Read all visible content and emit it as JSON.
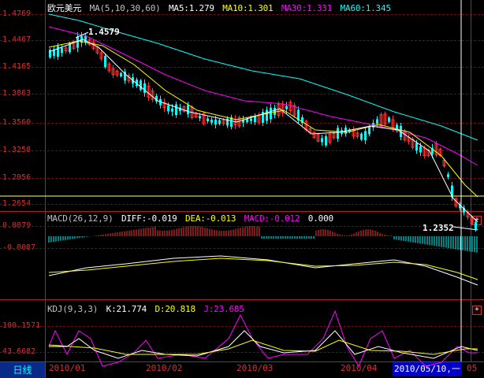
{
  "kline": {
    "symbol": "欧元美元",
    "ma_param": "MA(5,10,30,60)",
    "ma5": "MA5:1.279",
    "ma10": "MA10:1.301",
    "ma30": "MA30:1.331",
    "ma60": "MA60:1.345",
    "y_ticks": [
      "1.4769",
      "1.4467",
      "1.4165",
      "1.3863",
      "1.3560",
      "1.3258",
      "1.2956",
      "1.2654"
    ],
    "high_annotation": "1.4579",
    "low_annotation": "1.2352"
  },
  "macd": {
    "param": "MACD(26,12,9)",
    "diff": "DIFF:-0.019",
    "dea": "DEA:-0.013",
    "macd": "MACD:-0.012",
    "zero": "0.000",
    "y_ticks": [
      "0.0079",
      "-0.0087"
    ]
  },
  "kdj": {
    "param": "KDJ(9,3,3)",
    "k": "K:21.774",
    "d": "D:20.818",
    "j": "J:23.685",
    "y_ticks": [
      "100.1571",
      "43.6682"
    ]
  },
  "footer": {
    "period_tab": "日线",
    "dates": [
      "2010/01",
      "2010/02",
      "2010/03",
      "2010/04"
    ],
    "cursor_date": "2010/05/10,一",
    "tail_date": "05"
  },
  "colors": {
    "up": "#ff3232",
    "down": "#00ffff",
    "ma5": "#ffffff",
    "ma10": "#ffff00",
    "ma30": "#ff00ff",
    "ma60": "#00ffff",
    "grid": "#b41e1e"
  }
}
